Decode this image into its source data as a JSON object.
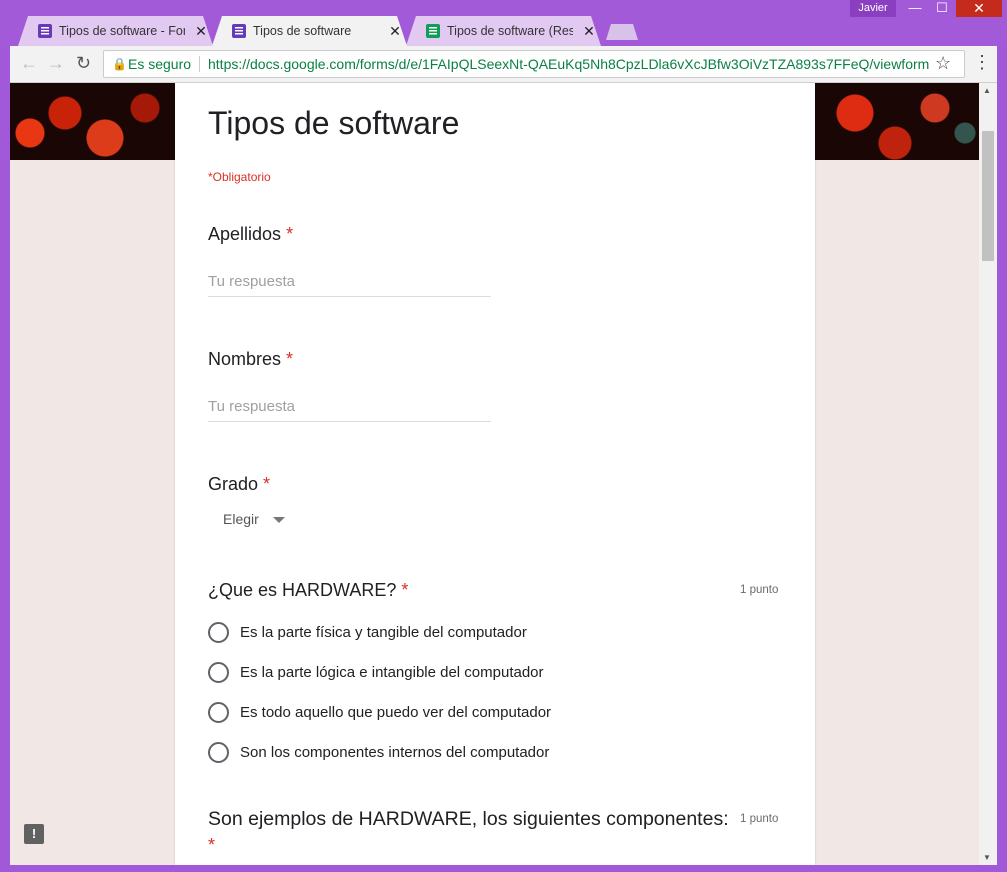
{
  "window": {
    "user": "Javier",
    "minimize": "—",
    "maximize": "☐",
    "close": "✕"
  },
  "tabs": [
    {
      "label": "Tipos de software - Form",
      "icon": "forms-icon",
      "close": "✕"
    },
    {
      "label": "Tipos de software",
      "icon": "forms-icon",
      "close": "✕"
    },
    {
      "label": "Tipos de software (Respu",
      "icon": "sheets-icon",
      "close": "✕"
    }
  ],
  "toolbar": {
    "back": "←",
    "forward": "→",
    "reload": "↻",
    "secure_label": "Es seguro",
    "url": "https://docs.google.com/forms/d/e/1FAIpQLSeexNt-QAEuKq5Nh8CpzLDla6vXcJBfw3OiVzTZA893s7FFeQ/viewform",
    "bookmark": "☆",
    "menu": "⋮"
  },
  "form": {
    "title": "Tipos de software",
    "required_note": "*Obligatorio",
    "required_mark": "*",
    "questions": [
      {
        "title": "Apellidos",
        "placeholder": "Tu respuesta"
      },
      {
        "title": "Nombres",
        "placeholder": "Tu respuesta"
      },
      {
        "title": "Grado",
        "select_value": "Elegir"
      },
      {
        "title": "¿Que es HARDWARE?",
        "points": "1 punto",
        "options": [
          "Es la parte física y tangible del computador",
          "Es la parte lógica e intangible del computador",
          "Es todo aquello que puedo ver del computador",
          "Son los componentes internos del computador"
        ]
      },
      {
        "title": "Son ejemplos de HARDWARE, los siguientes componentes:",
        "points": "1 punto"
      }
    ]
  },
  "feedback": "!"
}
